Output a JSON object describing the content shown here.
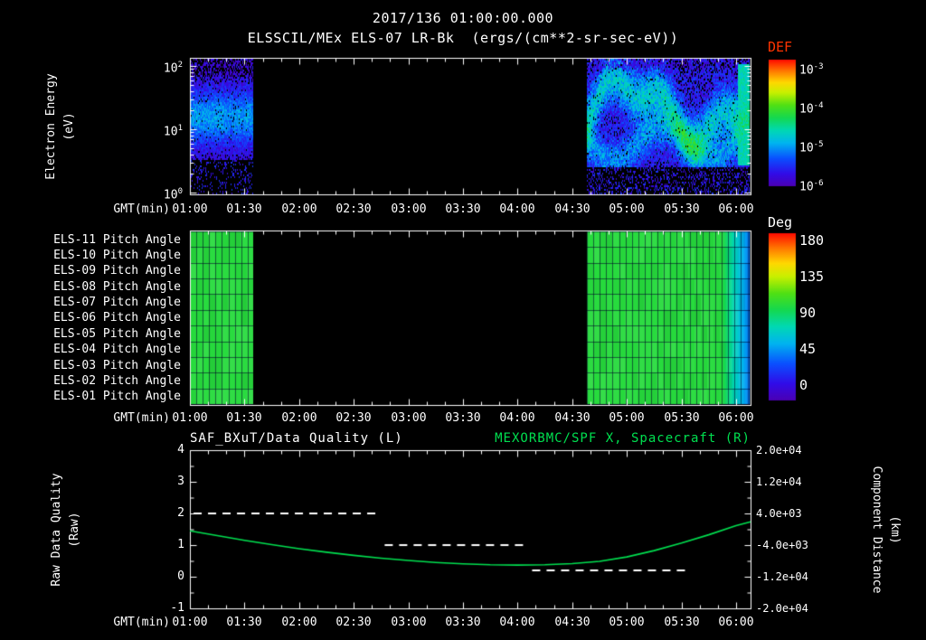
{
  "header": {
    "datetime": "2017/136 01:00:00.000",
    "instrument_line": "ELSSCIL/MEx ELS-07 LR-Bk  (ergs/(cm**2-sr-sec-eV))"
  },
  "time_axis": {
    "label": "GMT(min)",
    "ticks": [
      "01:00",
      "01:30",
      "02:00",
      "02:30",
      "03:00",
      "03:30",
      "04:00",
      "04:30",
      "05:00",
      "05:30",
      "06:00"
    ]
  },
  "colors": {
    "background": "#000000",
    "foreground": "#ffffff",
    "def_title": "#ff3300",
    "green_series": "#00e050"
  },
  "spectrogram_panel": {
    "ylabel_line1": "Electron Energy",
    "ylabel_line2": "(eV)",
    "yticks": [
      {
        "base": "10",
        "exp": "2"
      },
      {
        "base": "10",
        "exp": "1"
      },
      {
        "base": "10",
        "exp": "0"
      }
    ],
    "colorbar": {
      "title": "DEF",
      "ticks": [
        {
          "base": "10",
          "exp": "-3"
        },
        {
          "base": "10",
          "exp": "-4"
        },
        {
          "base": "10",
          "exp": "-5"
        },
        {
          "base": "10",
          "exp": "-6"
        }
      ]
    }
  },
  "pitch_panel": {
    "row_labels": [
      "ELS-11 Pitch Angle",
      "ELS-10 Pitch Angle",
      "ELS-09 Pitch Angle",
      "ELS-08 Pitch Angle",
      "ELS-07 Pitch Angle",
      "ELS-06 Pitch Angle",
      "ELS-05 Pitch Angle",
      "ELS-04 Pitch Angle",
      "ELS-03 Pitch Angle",
      "ELS-02 Pitch Angle",
      "ELS-01 Pitch Angle"
    ],
    "colorbar": {
      "title": "Deg",
      "ticks": [
        "180",
        "135",
        "90",
        "45",
        "0"
      ]
    }
  },
  "line_panel": {
    "left_title": "SAF_BXuT/Data Quality (L)",
    "right_title": "MEXORBMC/SPF X, Spacecraft (R)",
    "left_axis": {
      "label_line1": "Raw Data Quality",
      "label_line2": "(Raw)",
      "ticks": [
        "4",
        "3",
        "2",
        "1",
        "0",
        "-1"
      ]
    },
    "right_axis": {
      "label_line1": "Component Distance",
      "label_line2": "(km)",
      "ticks": [
        "2.0e+04",
        "1.2e+04",
        "4.0e+03",
        "-4.0e+03",
        "-1.2e+04",
        "-2.0e+04"
      ]
    }
  },
  "chart_data": [
    {
      "type": "heatmap",
      "name": "electron_energy_spectrogram",
      "title": "ELSSCIL/MEx ELS-07 LR-Bk",
      "units": "ergs/(cm**2-sr-sec-eV)",
      "xlabel": "GMT(min)",
      "x_ticks": [
        "01:00",
        "01:30",
        "02:00",
        "02:30",
        "03:00",
        "03:30",
        "04:00",
        "04:30",
        "05:00",
        "05:30",
        "06:00"
      ],
      "x_range_min": [
        60,
        368
      ],
      "ylabel": "Electron Energy (eV)",
      "y_scale": "log",
      "y_range_ev": [
        1,
        200
      ],
      "colorbar_label": "DEF",
      "colorbar_ticks": [
        "1e-3",
        "1e-4",
        "1e-5",
        "1e-6"
      ],
      "value_range_log10": [
        -6.2,
        -3
      ],
      "coverage": [
        {
          "start_min": 60,
          "end_min": 95,
          "style": "faint",
          "flux_log10_mean": -5.6,
          "note": "faint blue/purple flux, enhanced cyan band near 8-30 eV"
        },
        {
          "start_min": 278,
          "end_min": 368,
          "style": "bright",
          "flux_log10_mean": -4.8,
          "note": "structured cyan/green wavy bands 3-100 eV, bright green column near 06:05"
        }
      ]
    },
    {
      "type": "heatmap",
      "name": "pitch_angle_rows",
      "rows": [
        "ELS-11 Pitch Angle",
        "ELS-10 Pitch Angle",
        "ELS-09 Pitch Angle",
        "ELS-08 Pitch Angle",
        "ELS-07 Pitch Angle",
        "ELS-06 Pitch Angle",
        "ELS-05 Pitch Angle",
        "ELS-04 Pitch Angle",
        "ELS-03 Pitch Angle",
        "ELS-02 Pitch Angle",
        "ELS-01 Pitch Angle"
      ],
      "value_units": "Deg",
      "value_range": [
        0,
        180
      ],
      "colorbar_ticks": [
        180,
        135,
        90,
        45,
        0
      ],
      "coverage": [
        {
          "start_min": 60,
          "end_min": 95,
          "pitch_deg": 103
        },
        {
          "start_min": 278,
          "end_min": 352,
          "pitch_deg": 103
        },
        {
          "start_min": 352,
          "end_min": 368,
          "pitch_deg_from": 103,
          "pitch_deg_to": 45
        }
      ]
    },
    {
      "type": "line",
      "name": "quality_and_spacecraft_x",
      "xlabel": "GMT(min)",
      "left_axis": {
        "label": "Raw Data Quality (Raw)",
        "range": [
          -1,
          4
        ]
      },
      "right_axis": {
        "label": "Component Distance (km)",
        "range": [
          -20000,
          20000
        ]
      },
      "series": [
        {
          "name": "SAF_BXuT/Data Quality (L)",
          "axis": "left",
          "style": "dashed",
          "color": "#ffffff",
          "segments": [
            {
              "start_min": 62,
              "end_min": 164,
              "value": 2
            },
            {
              "start_min": 167,
              "end_min": 246,
              "value": 1
            },
            {
              "start_min": 248,
              "end_min": 333,
              "value": 0.2
            }
          ]
        },
        {
          "name": "MEXORBMC/SPF X, Spacecraft (R)",
          "axis": "right",
          "style": "solid",
          "color": "#00e050",
          "x_min": [
            60,
            75,
            90,
            105,
            120,
            135,
            150,
            165,
            180,
            195,
            210,
            225,
            240,
            255,
            270,
            285,
            300,
            315,
            330,
            345,
            360,
            368
          ],
          "values_km": [
            -400,
            -1600,
            -2800,
            -3900,
            -4900,
            -5800,
            -6600,
            -7300,
            -7900,
            -8400,
            -8750,
            -8980,
            -9050,
            -8980,
            -8700,
            -8100,
            -7000,
            -5400,
            -3500,
            -1400,
            900,
            1900
          ]
        }
      ]
    }
  ]
}
